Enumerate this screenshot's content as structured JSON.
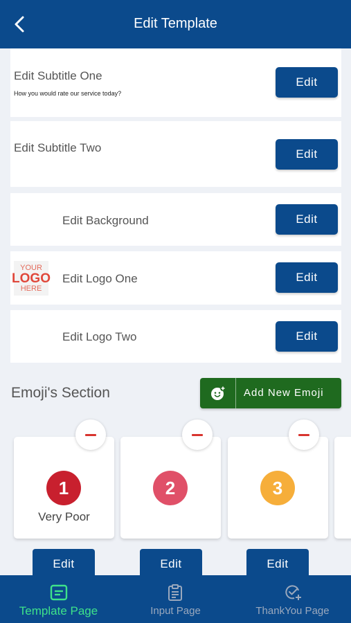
{
  "header": {
    "title": "Edit Template",
    "back_icon": "chevron-left-icon"
  },
  "rows": [
    {
      "label": "Edit Subtitle One",
      "sub": "How you would rate our service today?",
      "button": "Edit"
    },
    {
      "label": "Edit Subtitle Two",
      "button": "Edit"
    },
    {
      "label": "Edit Background",
      "button": "Edit"
    },
    {
      "label": "Edit Logo One",
      "button": "Edit",
      "logo": {
        "line1": "YOUR",
        "line2": "LOGO",
        "line3": "HERE"
      }
    },
    {
      "label": "Edit Logo Two",
      "button": "Edit"
    }
  ],
  "emoji_section": {
    "title": "Emoji's Section",
    "add_button": "Add New Emoji",
    "add_icon": "emoji-add-icon",
    "items": [
      {
        "number": "1",
        "label": "Very Poor",
        "color": "#c8202e",
        "edit": "Edit"
      },
      {
        "number": "2",
        "label": "",
        "color": "#e05068",
        "edit": "Edit"
      },
      {
        "number": "3",
        "label": "",
        "color": "#f6ae3a",
        "edit": "Edit"
      }
    ]
  },
  "nav": [
    {
      "label": "Template Page",
      "icon": "template-icon",
      "active": true,
      "color": "#3ee28a"
    },
    {
      "label": "Input Page",
      "icon": "clipboard-icon",
      "active": false,
      "color": "#9aa8bd"
    },
    {
      "label": "ThankYou Page",
      "icon": "check-badge-icon",
      "active": false,
      "color": "#9aa8bd"
    }
  ],
  "colors": {
    "primary": "#0b4a8c",
    "success": "#1f6a1f",
    "danger": "#d8342e"
  }
}
